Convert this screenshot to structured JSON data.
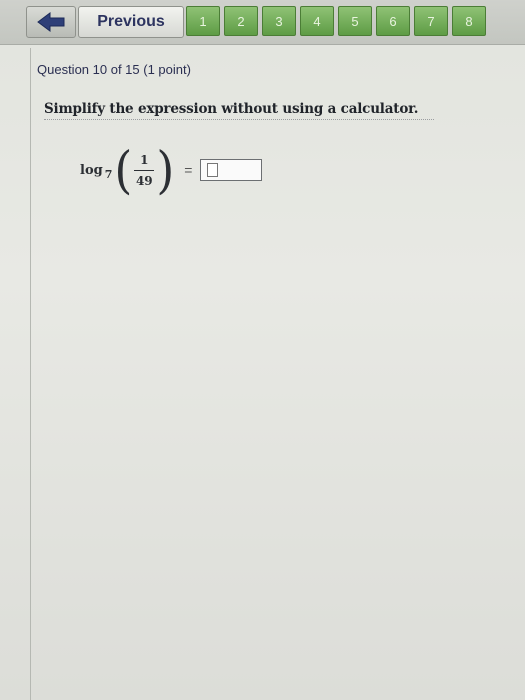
{
  "nav": {
    "previous_label": "Previous",
    "pages": [
      "1",
      "2",
      "3",
      "4",
      "5",
      "6",
      "7",
      "8"
    ]
  },
  "question": {
    "header": "Question 10 of 15 (1 point)",
    "prompt": "Simplify the expression without using a calculator.",
    "log_text": "log",
    "log_base": "7",
    "numerator": "1",
    "denominator": "49",
    "equals": "=",
    "answer_value": ""
  },
  "colors": {
    "page_tab": "#6ea655",
    "prompt_text": "#20242a",
    "header_text": "#2b2f52"
  }
}
